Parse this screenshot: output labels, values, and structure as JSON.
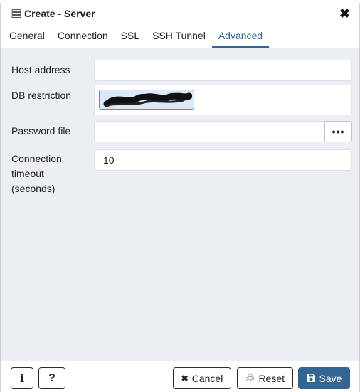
{
  "window": {
    "title": "Create - Server",
    "title_icon": "server-icon",
    "close_icon": "close-icon",
    "close_glyph": "✖"
  },
  "tabs": [
    {
      "label": "General",
      "active": false
    },
    {
      "label": "Connection",
      "active": false
    },
    {
      "label": "SSL",
      "active": false
    },
    {
      "label": "SSH Tunnel",
      "active": false
    },
    {
      "label": "Advanced",
      "active": true
    }
  ],
  "form": {
    "host_address": {
      "label": "Host address",
      "value": ""
    },
    "db_restriction": {
      "label": "DB restriction",
      "value_redacted": true
    },
    "password_file": {
      "label": "Password file",
      "value": "",
      "browse_label": "•••"
    },
    "connection_timeout": {
      "label_lines": [
        "Connection",
        "timeout",
        "(seconds)"
      ],
      "value": "10"
    }
  },
  "footer": {
    "info_icon": "info-icon",
    "info_glyph": "i",
    "help_icon": "help-icon",
    "help_glyph": "?",
    "cancel_label": "Cancel",
    "cancel_glyph": "✖",
    "reset_label": "Reset",
    "reset_glyph": "♲",
    "save_label": "Save",
    "save_glyph": "💾"
  },
  "colors": {
    "accent": "#326690",
    "content_bg": "#ebeef3",
    "border": "#dde0e6"
  }
}
